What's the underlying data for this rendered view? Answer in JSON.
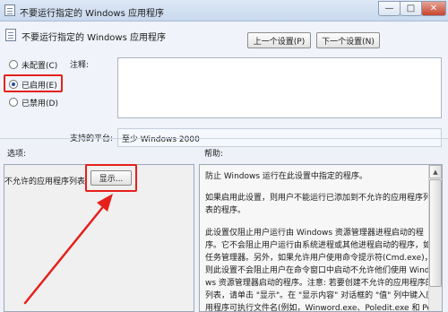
{
  "window": {
    "title": "不要运行指定的 Windows 应用程序",
    "minimize_glyph": "—",
    "maximize_glyph": "□",
    "close_glyph": "✕"
  },
  "header": {
    "policy_title": "不要运行指定的 Windows 应用程序",
    "prev_button": "上一个设置(P)",
    "next_button": "下一个设置(N)"
  },
  "state": {
    "options": [
      {
        "label": "未配置(C)",
        "checked": false
      },
      {
        "label": "已启用(E)",
        "checked": true
      },
      {
        "label": "已禁用(D)",
        "checked": false
      }
    ]
  },
  "comment": {
    "label": "注释:",
    "value": ""
  },
  "platform": {
    "label": "支持的平台:",
    "value": "至少 Windows 2000"
  },
  "sections": {
    "options_label": "选项:",
    "help_label": "帮助:"
  },
  "options_panel": {
    "item_label": "不允许的应用程序列表",
    "show_button": "显示..."
  },
  "help": {
    "paragraphs": [
      "防止 Windows 运行在此设置中指定的程序。",
      "如果启用此设置，则用户不能运行已添加到不允许的应用程序列表的程序。",
      "此设置仅阻止用户运行由 Windows 资源管理器进程启动的程序。它不会阻止用户运行由系统进程或其他进程启动的程序，如任务管理器。另外，如果允许用户使用命令提示符(Cmd.exe)，则此设置不会阻止用户在命令窗口中启动不允许他们使用 Windows 资源管理器启动的程序。注意: 若要创建不允许的应用程序的列表，请单击 \"显示\"。在 \"显示内容\" 对话框的 \"值\" 列中键入应用程序可执行文件名(例如，Winword.exe、Poledit.exe 和 Powerpnt.exe)。"
    ]
  },
  "colors": {
    "annotation_red": "#e5201c"
  }
}
